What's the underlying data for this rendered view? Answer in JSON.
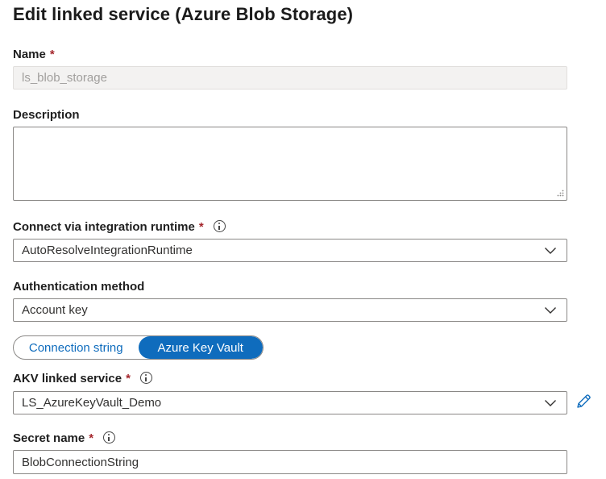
{
  "panel": {
    "title": "Edit linked service (Azure Blob Storage)"
  },
  "name_field": {
    "label": "Name",
    "required_mark": "*",
    "value": "ls_blob_storage"
  },
  "description_field": {
    "label": "Description",
    "value": ""
  },
  "runtime_field": {
    "label": "Connect via integration runtime",
    "required_mark": "*",
    "selected": "AutoResolveIntegrationRuntime"
  },
  "auth_field": {
    "label": "Authentication method",
    "selected": "Account key"
  },
  "connection_toggle": {
    "options": [
      "Connection string",
      "Azure Key Vault"
    ],
    "selected": "Azure Key Vault"
  },
  "akv_field": {
    "label": "AKV linked service",
    "required_mark": "*",
    "selected": "LS_AzureKeyVault_Demo"
  },
  "secret_field": {
    "label": "Secret name",
    "required_mark": "*",
    "value": "BlobConnectionString"
  },
  "icons": {
    "info": "info-icon",
    "dropdown": "chevron-down-icon",
    "edit": "pencil-icon",
    "resize": "resize-grip-icon"
  },
  "colors": {
    "accent": "#0f6cbd",
    "required": "#a4262c",
    "border": "#8a8886",
    "disabled_bg": "#f3f2f1"
  }
}
